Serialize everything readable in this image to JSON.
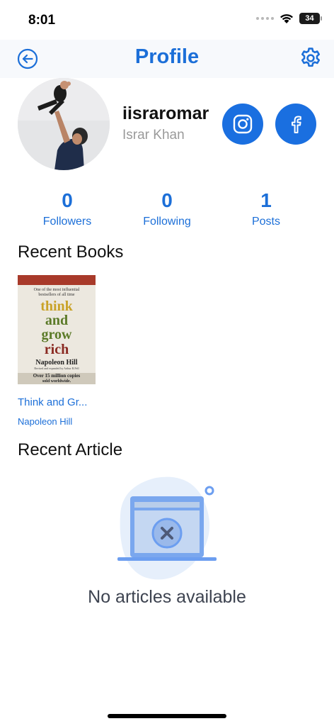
{
  "status_bar": {
    "time": "8:01",
    "battery": "34"
  },
  "header": {
    "title": "Profile"
  },
  "profile": {
    "username": "iisraromar",
    "full_name": "Israr Khan"
  },
  "stats": [
    {
      "value": "0",
      "label": "Followers"
    },
    {
      "value": "0",
      "label": "Following"
    },
    {
      "value": "1",
      "label": "Posts"
    }
  ],
  "sections": {
    "recent_books": "Recent Books",
    "recent_article": "Recent Article"
  },
  "books": [
    {
      "title": "Think and Gr...",
      "author": "Napoleon Hill",
      "cover": {
        "tagline_1": "One of the most influential",
        "tagline_2": "bestsellers of all time",
        "line_1": "think",
        "line_2": "and",
        "line_3": "grow",
        "line_4": "rich",
        "author": "Napoleon Hill",
        "subtitle": "Revised and expanded by Arthur R.Pell",
        "sales_1": "Over 15 million copies",
        "sales_2": "sold worldwide."
      }
    }
  ],
  "empty_state": {
    "message": "No articles available"
  },
  "colors": {
    "accent": "#1c6fd8",
    "social": "#1a6fe0",
    "muted": "#9a9a9a"
  },
  "icons": {
    "back": "arrow-left-circle-icon",
    "settings": "gear-icon",
    "instagram": "instagram-icon",
    "facebook": "facebook-icon"
  }
}
